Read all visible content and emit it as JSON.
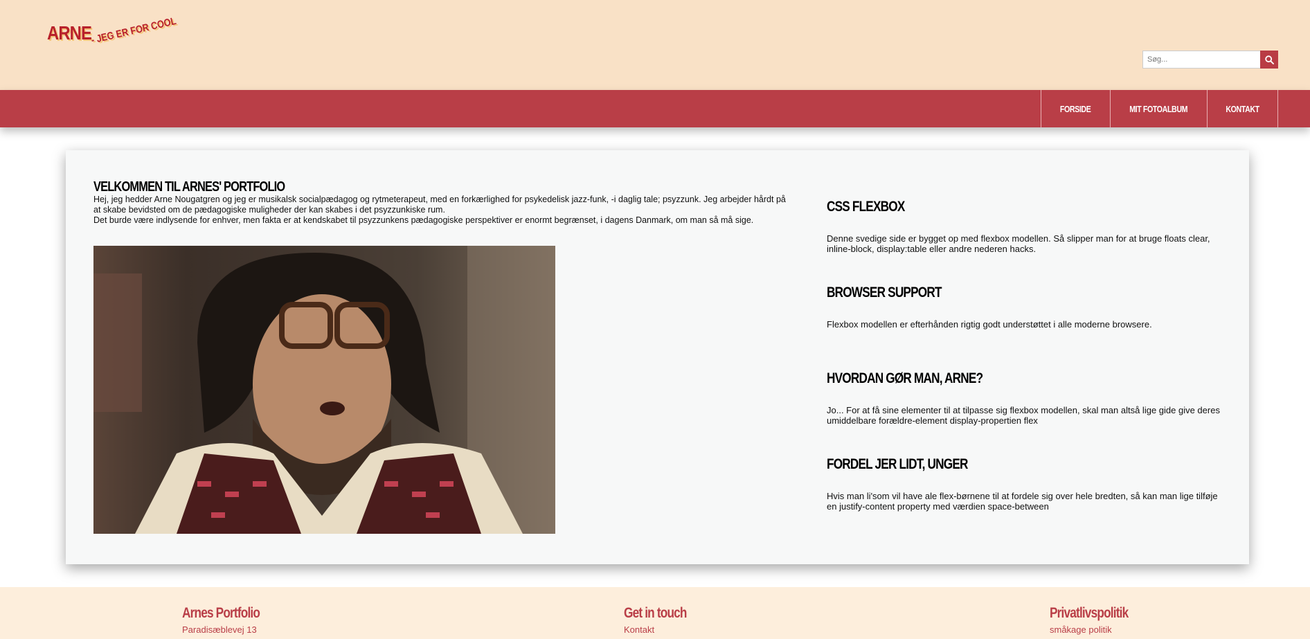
{
  "header": {
    "logo_main": "ARNE",
    "logo_tagline": "- JEG ER FOR COOL",
    "search_placeholder": "Søg..."
  },
  "nav": {
    "items": [
      {
        "label": "FORSIDE"
      },
      {
        "label": "MIT FOTOALBUM"
      },
      {
        "label": "KONTAKT"
      }
    ]
  },
  "main": {
    "title": "VELKOMMEN TIL ARNES' PORTFOLIO",
    "intro_1": "Hej, jeg hedder Arne Nougatgren og jeg er musikalsk socialpædagog og rytmeterapeut, med en forkærlighed for psykedelisk jazz-funk, -i daglig tale; psyzzunk. Jeg arbejder hårdt på at skabe bevidsted om de pædagogiske muligheder der kan skabes i det psyzzunkiske rum.",
    "intro_2": "Det burde være indlysende for enhver, men fakta er at kendskabet til psyzzunkens pædagogiske perspektiver er enormt begrænset, i dagens Danmark, om man så må sige."
  },
  "sidebar": {
    "sections": [
      {
        "title": "CSS FLEXBOX",
        "text": "Denne svedige side er bygget op med flexbox modellen. Så slipper man for at bruge floats clear, inline-block, display:table eller andre nederen hacks."
      },
      {
        "title": "BROWSER SUPPORT",
        "text": "Flexbox modellen er efterhånden rigtig godt understøttet i alle moderne browsere."
      },
      {
        "title": "HVORDAN GØR MAN, ARNE?",
        "text": "Jo... For at få sine elementer til at tilpasse sig flexbox modellen, skal man altså lige gide give deres umiddelbare forældre-element display-propertien flex"
      },
      {
        "title": "FORDEL JER LIDT, UNGER",
        "text": "Hvis man li'som vil have ale flex-børnene til at fordele sig over hele bredten, så kan man lige tilføje en justify-content property med værdien space-between"
      }
    ]
  },
  "footer": {
    "col1_title": "Arnes Portfolio",
    "col1_link": "Paradisæblevej 13",
    "col2_title": "Get in touch",
    "col2_link": "Kontakt",
    "col3_title": "Privatlivspolitik",
    "col3_link": "småkage politik"
  },
  "colors": {
    "header_bg": "#f9e1c6",
    "nav_bg": "#b93e47",
    "accent": "#b8212b",
    "footer_bg": "#fdeedc"
  }
}
